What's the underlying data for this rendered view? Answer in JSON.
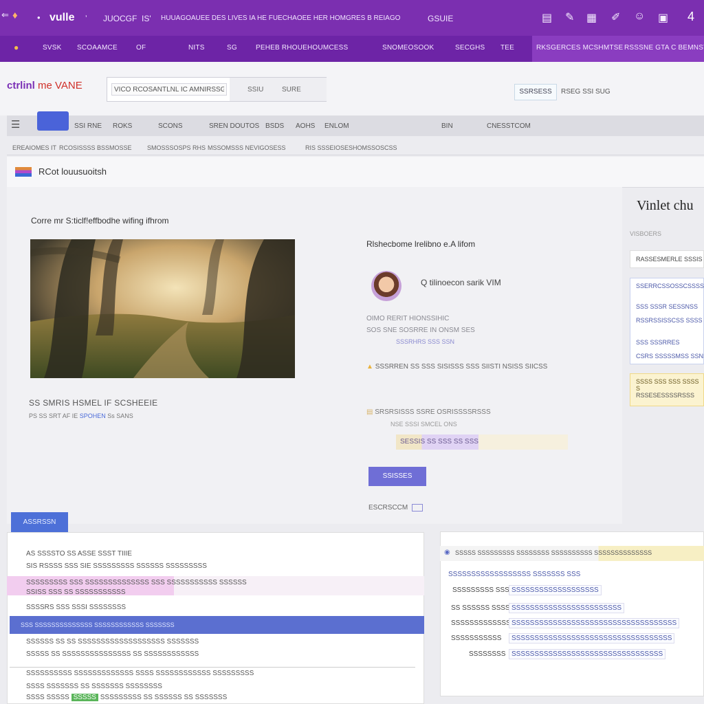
{
  "topbar": {
    "app_name": "vulle",
    "items": [
      "JUOCGF",
      "IS'",
      "HUUAGOAUEE DES LIVES IA HE FUECHAOEE HER HOMGRES B REIAGO",
      "GSUIE"
    ],
    "icons": [
      "layout-icon",
      "pen-icon",
      "grid-icon",
      "pencil-icon",
      "user-icon",
      "lock-icon"
    ],
    "badge": "4"
  },
  "subbar": {
    "items": [
      "SVSK",
      "SCOAAMCE",
      "OF",
      "NITS",
      "SG",
      "PEHEB RHOUEHOUMCESS",
      "SNOMEOSOOK",
      "SECGHS",
      "TEE"
    ],
    "right_items": [
      "RKSGERCES MCSHMTSE",
      "RSSSNE GTA C BEMNSTS"
    ]
  },
  "header": {
    "logo": "ctrlinl",
    "logo_accent": "me VANE",
    "search_value": "VICO RCOSANTLNL IC AMNIRSSG",
    "search_buttons": [
      "SSIU",
      "SURE"
    ],
    "auth_button": "SSRSESS",
    "auth_text": "RSEG SSI SUG"
  },
  "nav": {
    "items": [
      "SSI RNE",
      "ROKS",
      "SCONS",
      "SREN DOUTOS",
      "BSDS",
      "AOHS",
      "ENLOM",
      "BIN",
      "CNESSTCOM"
    ]
  },
  "breadcrumbs": [
    "EREAIOMES IT",
    "RCOSISSSS BSSMOSSE",
    "SMOSSSOSPS RHS",
    "MSSOMSSS NEVIGOSESS",
    "RIS SSSEIOSESHOMSSOSCSS"
  ],
  "section": {
    "title": "RCot louusuoitsh"
  },
  "main": {
    "caption": "Corre mr S:ticlf!effbodhe wifing ifhrom",
    "photo_title": "SS SMRIS HSMEL IF SCSHEEIE",
    "photo_meta": "PS SS SRT AF IE",
    "photo_meta_link": "SPOHEN",
    "photo_meta_tail": "Ss SANS",
    "post_head": "Rlshecbome lrelibno e.A lifom",
    "user_name": "Q tilinoecon sarik VIM",
    "details": [
      "OIMO RERIT HIONSSIHIC",
      "SOS SNE SOSRRE IN ONSM SES",
      "SSSRHRS SSS SSN"
    ],
    "rating_text": "SSSRREN SS SSS SISISSS SSS SIISTI NSISS SIICSS",
    "attachment": "SRSRSISSS SSRE OSRISSSSRSSS",
    "attachment_sub": "NSE SSSI SMCEL ONS",
    "tags": "SESSIS SS SSS SS SSS",
    "primary_button": "SSISSES",
    "small_link": "ESCRSCCM"
  },
  "sidebar": {
    "title": "Vinlet chu",
    "subtitle": "VISBOERS",
    "box_text": "RASSESMERLE SSSIS",
    "list": [
      "SSERRCSSOSSCSSSSISS",
      "SSS SSSR SESSNSS",
      "RSSRSSISSCSS SSSS",
      "SSS SSSRRES",
      "CSRS SSSSSMSS SSNS"
    ],
    "note_lines": [
      "SSSS SSS SSS SSSS S",
      "RSSESESSSSRSSS"
    ]
  },
  "bottom_left": {
    "tab_label": "ASSRSSN",
    "lines": [
      "AS SSSSTO SS ASSE SSST TIIIE",
      "SIS RSSSS SSS SIE SSSSSSSSS SSSSSS SSSSSSSSS",
      "SSSSSSSSS SSS SSSSSSSSSSSSSS SSS SSSSSSSSSSS SSSSSS",
      "SSISS SSS SS SSSSSSSSSSS",
      "SSSSRS SSS SSSI SSSSSSSS",
      "SSSSSS SS SS SSSSSSSSSSSSSSSSSSS SSSSSSS",
      "SSSSS SS SSSSSSSSSSSSSSS SS SSSSSSSSSSSS",
      "SSSSSSSSSS SSSSSSSSSSSSS SSSS SSSSSSSSSSSS SSSSSSSSS",
      "SSSS SSSSSSS SS SSSSSSS SSSSSSSS",
      "SSSS SSSSS"
    ],
    "bar_text": "SSS SSSSSSSSSSSSSS SSSSSSSSSSSS SSSSSSS",
    "green_tag": "SSSSS",
    "last_tail": "SSSSSSSSS SS SSSSSS SS SSSSSSS"
  },
  "bottom_right": {
    "header": "SSSSS SSSSSSSSS SSSSSSSS SSSSSSSSSS SSSSSSSSSSSSSS",
    "rows": [
      {
        "label": "SSSSSSSSSSSSSSSSSS SSSSSSS SSS",
        "value": ""
      },
      {
        "label": "SSSSSSSSS SSSSS",
        "value": "SSSSSSSSSSSSSSSSSSS"
      },
      {
        "label": "SS SSSSSS SSSSS",
        "value": "SSSSSSSSSSSSSSSSSSSSSSSS"
      },
      {
        "label": "SSSSSSSSSSSSS",
        "value": "SSSSSSSSSSSSSSSSSSSSSSSSSSSSSSSSSSSS"
      },
      {
        "label": "SSSSSSSSSSS",
        "value": "SSSSSSSSSSSSSSSSSSSSSSSSSSSSSSSSSSS"
      },
      {
        "label": "SSSSSSSS",
        "value": "SSSSSSSSSSSSSSSSSSSSSSSSSSSSSSSSS"
      }
    ]
  },
  "colors": {
    "topbar": "#7b2fb0",
    "accent_blue": "#4a63d9",
    "highlight_pink": "#f2cdef",
    "note_yellow": "#fbf3d0"
  }
}
